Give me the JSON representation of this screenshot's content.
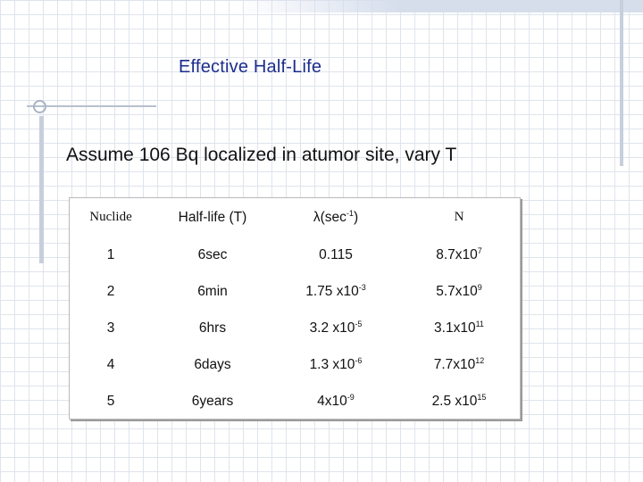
{
  "slide": {
    "title": "Effective Half-Life",
    "subtitle": "Assume 106 Bq localized in atumor site, vary T"
  },
  "table": {
    "headers": [
      {
        "base": "Nuclide",
        "sup": "",
        "rest": ""
      },
      {
        "base": "Half-life (T)",
        "sup": "",
        "rest": ""
      },
      {
        "base": "λ(sec",
        "sup": "-1",
        "rest": ")"
      },
      {
        "base": "N",
        "sup": "",
        "rest": ""
      }
    ],
    "rows": [
      {
        "nuclide": "1",
        "half_life": "6sec",
        "lambda": {
          "base": "0.115",
          "sup": ""
        },
        "n": {
          "base": "8.7x10",
          "sup": "7"
        }
      },
      {
        "nuclide": "2",
        "half_life": "6min",
        "lambda": {
          "base": "1.75 x10",
          "sup": "-3"
        },
        "n": {
          "base": "5.7x10",
          "sup": "9"
        }
      },
      {
        "nuclide": "3",
        "half_life": "6hrs",
        "lambda": {
          "base": "3.2 x10",
          "sup": "-5"
        },
        "n": {
          "base": "3.1x10",
          "sup": "11"
        }
      },
      {
        "nuclide": "4",
        "half_life": "6days",
        "lambda": {
          "base": "1.3 x10",
          "sup": "-6"
        },
        "n": {
          "base": "7.7x10",
          "sup": "12"
        }
      },
      {
        "nuclide": "5",
        "half_life": "6years",
        "lambda": {
          "base": "4x10",
          "sup": "-9"
        },
        "n": {
          "base": "2.5 x10",
          "sup": "15"
        }
      }
    ]
  }
}
